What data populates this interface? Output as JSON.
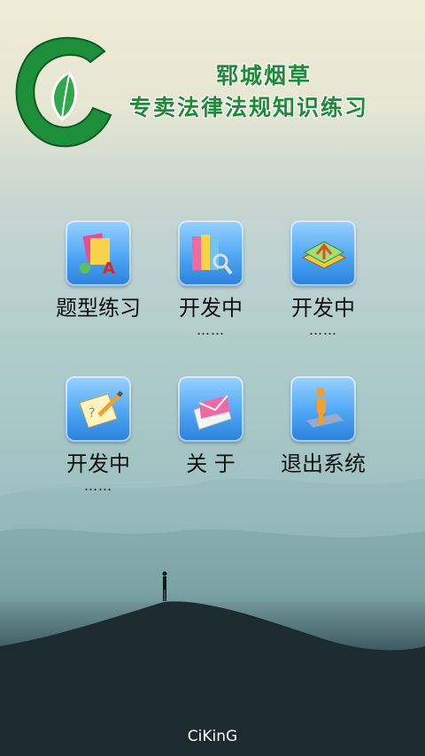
{
  "header": {
    "title_line1": "郓城烟草",
    "title_line2": "专卖法律法规知识练习"
  },
  "menu": [
    {
      "label": "题型练习",
      "sub": "",
      "icon": "book-stack-icon"
    },
    {
      "label": "开发中",
      "sub": "……",
      "icon": "books-search-icon"
    },
    {
      "label": "开发中",
      "sub": "……",
      "icon": "book-arrows-icon"
    },
    {
      "label": "开发中",
      "sub": "……",
      "icon": "notebook-pencil-icon"
    },
    {
      "label": "关 于",
      "sub": "",
      "icon": "envelope-icon"
    },
    {
      "label": "退出系统",
      "sub": "",
      "icon": "person-chair-icon"
    }
  ],
  "footer": {
    "text": "CiKinG"
  },
  "colors": {
    "brand_green": "#1f8a38",
    "tile_blue": "#4ea6f5"
  }
}
